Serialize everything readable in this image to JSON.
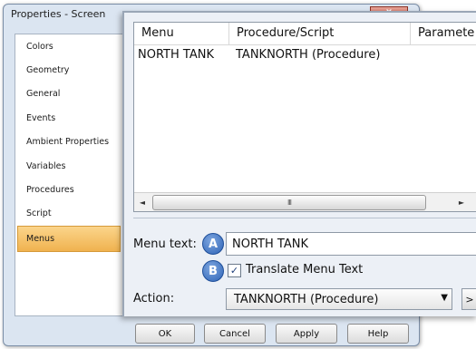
{
  "dialog": {
    "title": "Properties - Screen",
    "close_glyph": "x"
  },
  "sidebar": {
    "items": [
      {
        "label": "Colors"
      },
      {
        "label": "Geometry"
      },
      {
        "label": "General"
      },
      {
        "label": "Events"
      },
      {
        "label": "Ambient Properties"
      },
      {
        "label": "Variables"
      },
      {
        "label": "Procedures"
      },
      {
        "label": "Script"
      },
      {
        "label": "Menus"
      }
    ],
    "selected": "Menus"
  },
  "grid": {
    "columns": [
      "Menu",
      "Procedure/Script",
      "Paramete"
    ],
    "rows": [
      [
        "NORTH TANK",
        "TANKNORTH (Procedure)",
        ""
      ]
    ],
    "scroll_thumb": "III"
  },
  "form": {
    "menu_text_label": "Menu text:",
    "menu_text_value": "NORTH TANK",
    "marker_a": "A",
    "marker_b": "B",
    "translate_label": "Translate Menu Text",
    "translate_checked": true,
    "check_glyph": "✓",
    "action_label": "Action:",
    "action_value": "TANKNORTH (Procedure)",
    "action_more": ">"
  },
  "buttons": {
    "ok": "OK",
    "cancel": "Cancel",
    "apply": "Apply",
    "help": "Help"
  },
  "icons": {
    "scroll_left": "◄",
    "scroll_right": "►",
    "dropdown": "▼"
  }
}
